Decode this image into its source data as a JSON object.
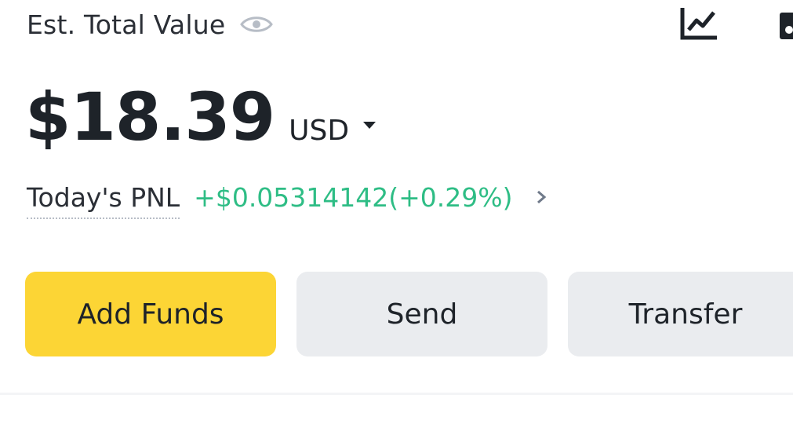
{
  "header": {
    "label": "Est. Total Value",
    "icons": {
      "visibility": "eye-icon",
      "chart": "line-chart-icon",
      "edge": "partial-icon"
    }
  },
  "balance": {
    "amount": "$18.39",
    "currency": "USD"
  },
  "pnl": {
    "label": "Today's PNL",
    "value": "+$0.05314142(+0.29%)"
  },
  "actions": {
    "add_funds": "Add Funds",
    "send": "Send",
    "transfer": "Transfer"
  },
  "colors": {
    "accent_yellow": "#fcd535",
    "positive_green": "#2ebd85",
    "button_gray": "#eaecef",
    "text_dark": "#1e2329"
  }
}
